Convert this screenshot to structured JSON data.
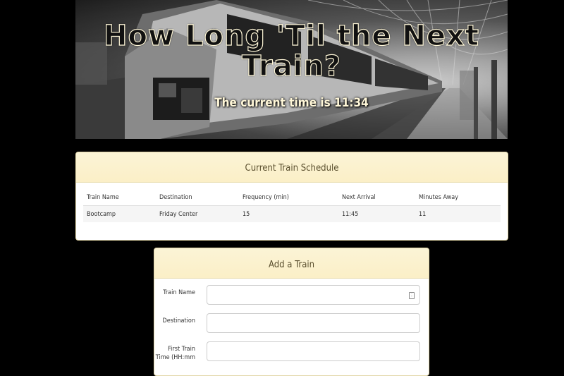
{
  "hero": {
    "title": "How Long 'Til the Next Train?",
    "current_time_text": "The current time is 11:34"
  },
  "schedule": {
    "title": "Current Train Schedule",
    "columns": [
      "Train Name",
      "Destination",
      "Frequency (min)",
      "Next Arrival",
      "Minutes Away"
    ],
    "rows": [
      [
        "Bootcamp",
        "Friday Center",
        "15",
        "11:45",
        "11"
      ]
    ]
  },
  "add_train": {
    "title": "Add a Train",
    "fields": [
      {
        "label": "Train Name",
        "value": ""
      },
      {
        "label": "Destination",
        "value": ""
      },
      {
        "label": "First Train Time (HH:mm",
        "value": ""
      }
    ]
  },
  "colors": {
    "page_background": "#000000",
    "card_header": "#fbf2cf",
    "title_outline": "#fff7d8"
  }
}
